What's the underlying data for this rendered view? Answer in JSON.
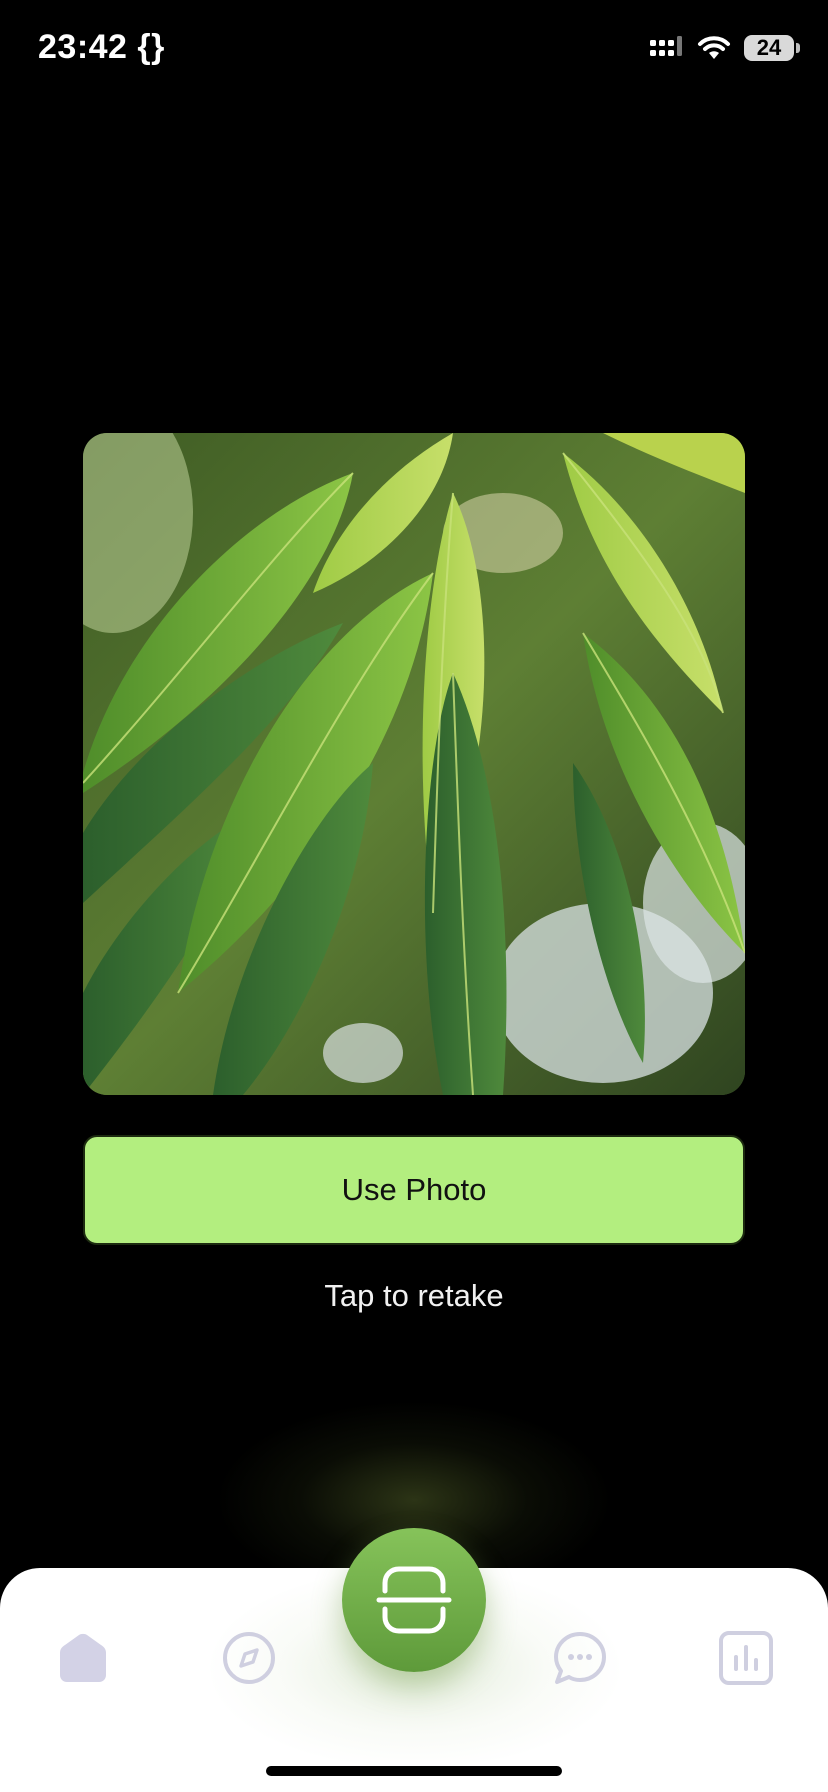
{
  "status_bar": {
    "time": "23:42 {}",
    "battery": "24",
    "icons": [
      "signal-icon",
      "wifi-icon",
      "battery-icon"
    ]
  },
  "preview": {
    "image": "leaf-photo"
  },
  "actions": {
    "use_photo_label": "Use Photo",
    "retake_label": "Tap to retake"
  },
  "tab_bar": {
    "items": [
      {
        "icon": "home-icon",
        "active": false
      },
      {
        "icon": "compass-icon",
        "active": false
      },
      {
        "icon": "scan-icon",
        "active": true
      },
      {
        "icon": "chat-icon",
        "active": false
      },
      {
        "icon": "stats-icon",
        "active": false
      }
    ]
  },
  "colors": {
    "accent": "#b3ee7f",
    "scan_button": "#6fae46",
    "tab_icon": "#cfcfe0",
    "background": "#000000"
  }
}
